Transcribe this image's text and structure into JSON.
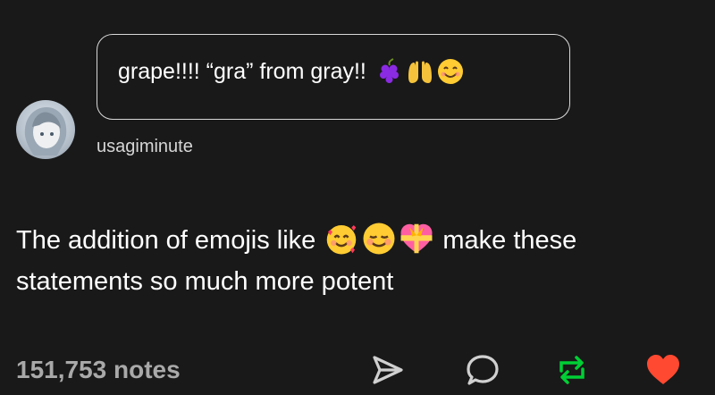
{
  "ask": {
    "text": "grape!!!! “gra” from gray!!",
    "emojis": [
      "grapes-emoji",
      "raised-hands-emoji",
      "smiling-face-emoji"
    ]
  },
  "author": {
    "username": "usagiminute"
  },
  "post": {
    "text_before": "The addition of emojis like ",
    "emojis": [
      "smiling-face-with-hearts-emoji",
      "smiling-face-blushing-emoji",
      "heart-with-ribbon-emoji"
    ],
    "text_after": " make these statements so much more potent"
  },
  "footer": {
    "notes": "151,753 notes",
    "actions": [
      "share-icon",
      "reply-icon",
      "reblog-icon",
      "heart-icon"
    ]
  },
  "colors": {
    "background": "#191919",
    "reblog": "#00cf35",
    "like": "#ff4930",
    "notes": "#a9a9a9"
  }
}
